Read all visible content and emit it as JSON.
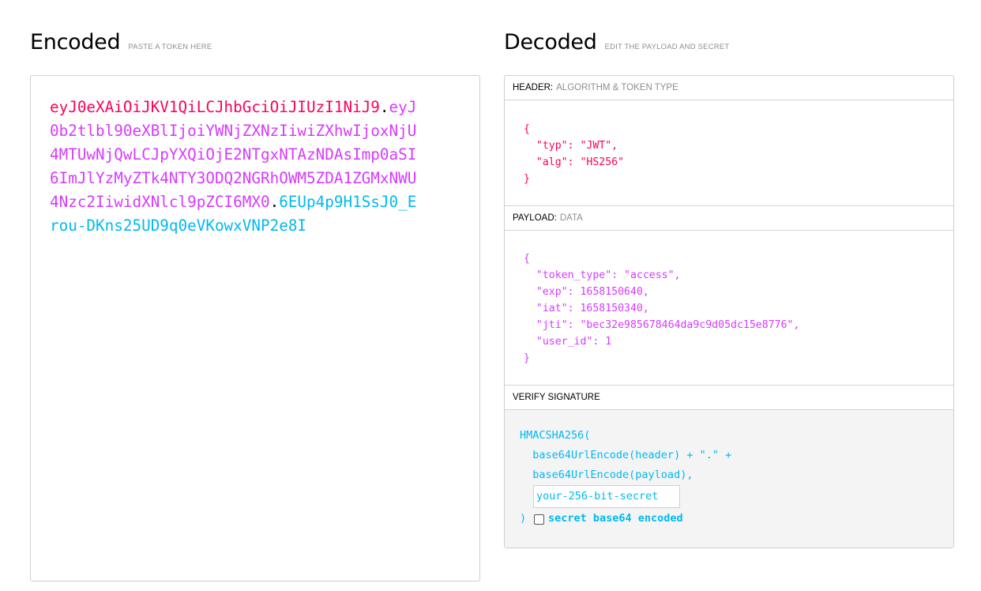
{
  "encoded": {
    "title": "Encoded",
    "subtitle": "PASTE A TOKEN HERE",
    "token_header": "eyJ0eXAiOiJKV1QiLCJhbGciOiJIUzI1NiJ9",
    "dot1": ".",
    "token_payload": "eyJ0b2tlbl90eXBlIjoiYWNjZXNzIiwiZXhwIjoxNjU4MTUwNjQwLCJpYXQiOjE2NTgxNTAzNDAsImp0aSI6ImJlYzMyZTk4NTY3ODQ2NGRhOWM5ZDA1ZGMxNWU4Nzc2IiwidXNlcl9pZCI6MX0",
    "dot2": ".",
    "token_signature": "6EUp4p9H1SsJ0_Erou-DKns25UD9q0eVKowxVNP2e8I"
  },
  "decoded": {
    "title": "Decoded",
    "subtitle": "EDIT THE PAYLOAD AND SECRET",
    "header_section": {
      "label": "HEADER:",
      "sublabel": "ALGORITHM & TOKEN TYPE",
      "lines": [
        "{",
        "  \"typ\": \"JWT\",",
        "  \"alg\": \"HS256\"",
        "}"
      ]
    },
    "payload_section": {
      "label": "PAYLOAD:",
      "sublabel": "DATA",
      "lines": [
        "{",
        "  \"token_type\": \"access\",",
        "  \"exp\": 1658150640,",
        "  \"iat\": 1658150340,",
        "  \"jti\": \"bec32e985678464da9c9d05dc15e8776\",",
        "  \"user_id\": 1",
        "}"
      ]
    },
    "signature_section": {
      "label": "VERIFY SIGNATURE",
      "line1": "HMACSHA256(",
      "line2": "  base64UrlEncode(header) + \".\" +",
      "line3": "  base64UrlEncode(payload),",
      "secret_value": "your-256-bit-secret",
      "close": ")",
      "checkbox_label": "secret base64 encoded",
      "checkbox_checked": false
    }
  },
  "colors": {
    "header": "#fb015b",
    "payload": "#d63aff",
    "signature": "#00b9f1"
  }
}
